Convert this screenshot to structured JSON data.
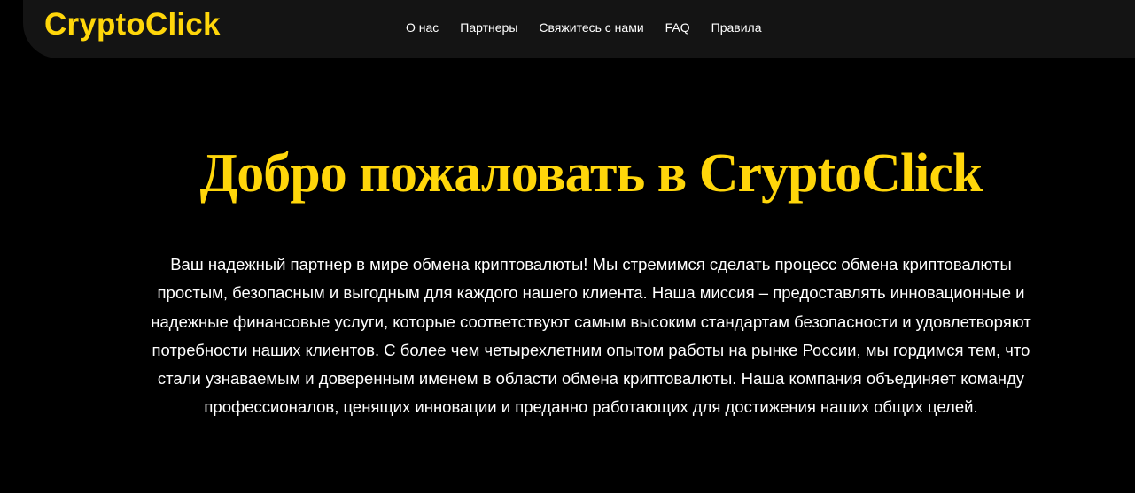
{
  "header": {
    "logo": "CryptoClick",
    "nav": [
      {
        "label": "О нас"
      },
      {
        "label": "Партнеры"
      },
      {
        "label": "Свяжитесь с нами"
      },
      {
        "label": "FAQ"
      },
      {
        "label": "Правила"
      }
    ]
  },
  "hero": {
    "title": "Добро пожаловать в CryptoClick",
    "description": "Ваш надежный партнер в мире обмена криптовалюты! Мы стремимся сделать процесс обмена криптовалюты простым, безопасным и выгодным для каждого нашего клиента. Наша миссия – предоставлять инновационные и надежные финансовые услуги, которые соответствуют самым высоким стандартам безопасности и удовлетворяют потребности наших клиентов. С более чем четырехлетним опытом работы на рынке России, мы гордимся тем, что стали узнаваемым и доверенным именем в области обмена криптовалюты. Наша компания объединяет команду профессионалов, ценящих инновации и преданно работающих для достижения наших общих целей."
  },
  "colors": {
    "background": "#000000",
    "navbar": "#141414",
    "accent": "#ffd60a",
    "text": "#ffffff"
  }
}
